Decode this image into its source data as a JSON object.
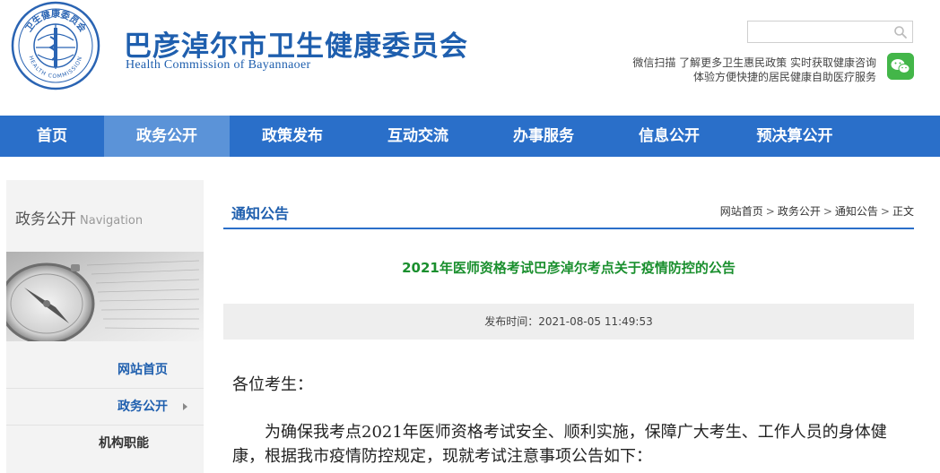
{
  "header": {
    "logo_text": "卫生健康委员会",
    "logo_text_en": "HEALTH COMMISSION",
    "title": "巴彦淖尔市卫生健康委员会",
    "subtitle": "Health Commission of Bayannaoer",
    "search": {
      "placeholder": ""
    },
    "wechat_line1": "微信扫描 了解更多卫生惠民政策 实时获取健康咨询",
    "wechat_line2": "体验方便快捷的居民健康自助医疗服务"
  },
  "nav": {
    "items": [
      "首页",
      "政务公开",
      "政策发布",
      "互动交流",
      "办事服务",
      "信息公开",
      "预决算公开"
    ],
    "active": "政务公开"
  },
  "sidebar": {
    "title": "政务公开",
    "title_en": "Navigation",
    "items": [
      "网站首页",
      "政务公开",
      "机构职能"
    ]
  },
  "main": {
    "section_title": "通知公告",
    "breadcrumb": [
      "网站首页",
      "政务公开",
      "通知公告",
      "正文"
    ],
    "breadcrumb_sep": ">",
    "article_title": "2021年医师资格考试巴彦淖尔考点关于疫情防控的公告",
    "publish_time": "发布时间：2021-08-05 11:49:53",
    "salutation": "各位考生：",
    "paragraph1": "为确保我考点2021年医师资格考试安全、顺利实施，保障广大考生、工作人员的身体健康，根据我市疫情防控规定，现就考试注意事项公告如下："
  },
  "colors": {
    "brand_blue": "#1f5fae",
    "nav_blue": "#2a6fc9",
    "nav_active": "#5b93d8",
    "title_green": "#1a8f2e",
    "wechat_green": "#43b649"
  },
  "icons": {
    "logo": "emblem-icon",
    "search": "search-icon",
    "wechat": "wechat-icon",
    "arrow": "chevron-right-icon"
  }
}
